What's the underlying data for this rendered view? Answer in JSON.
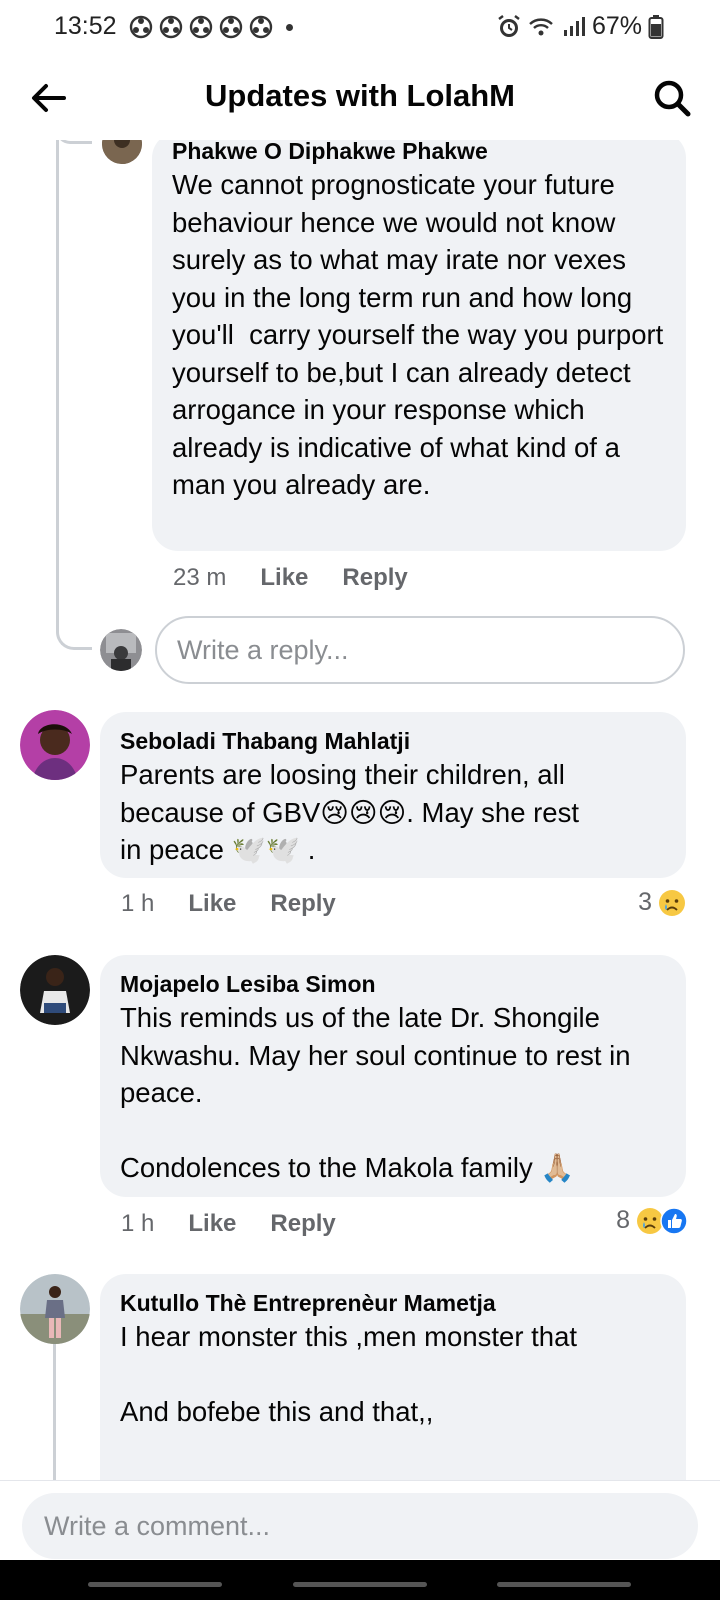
{
  "status_bar": {
    "time": "13:52",
    "battery": "67%"
  },
  "header": {
    "title": "Updates with LolahM"
  },
  "comments": [
    {
      "author": "Phakwe O Diphakwe Phakwe",
      "text": "We cannot prognosticate your future behaviour hence we would not know surely as to what may irate nor vexes you in the long term run and how long you'll  carry yourself the way you purport yourself to be,but I can already detect arrogance in your response which already is indicative of what kind of a man you already are.",
      "time": "23 m",
      "like": "Like",
      "reply": "Reply"
    },
    {
      "author": "Seboladi Thabang Mahlatji",
      "text_a": "Parents are loosing their children, all",
      "text_b": "because of GBV",
      "text_c": ". May she rest",
      "text_d": "in peace",
      "text_e": ".",
      "time": "1 h",
      "like": "Like",
      "reply": "Reply",
      "reaction_count": "3"
    },
    {
      "author": "Mojapelo Lesiba Simon",
      "text": "This reminds us of the late Dr. Shongile Nkwashu. May her soul continue to rest in peace.",
      "text2": "Condolences to the Makola family",
      "time": "1 h",
      "like": "Like",
      "reply": "Reply",
      "reaction_count": "8"
    },
    {
      "author": "Kutullo Thè Entreprenèur Mametja",
      "text": "I hear monster this ,men monster that",
      "text2": "And bofebe this and that,,"
    }
  ],
  "reply_placeholder": "Write a reply...",
  "comment_placeholder": "Write a comment..."
}
